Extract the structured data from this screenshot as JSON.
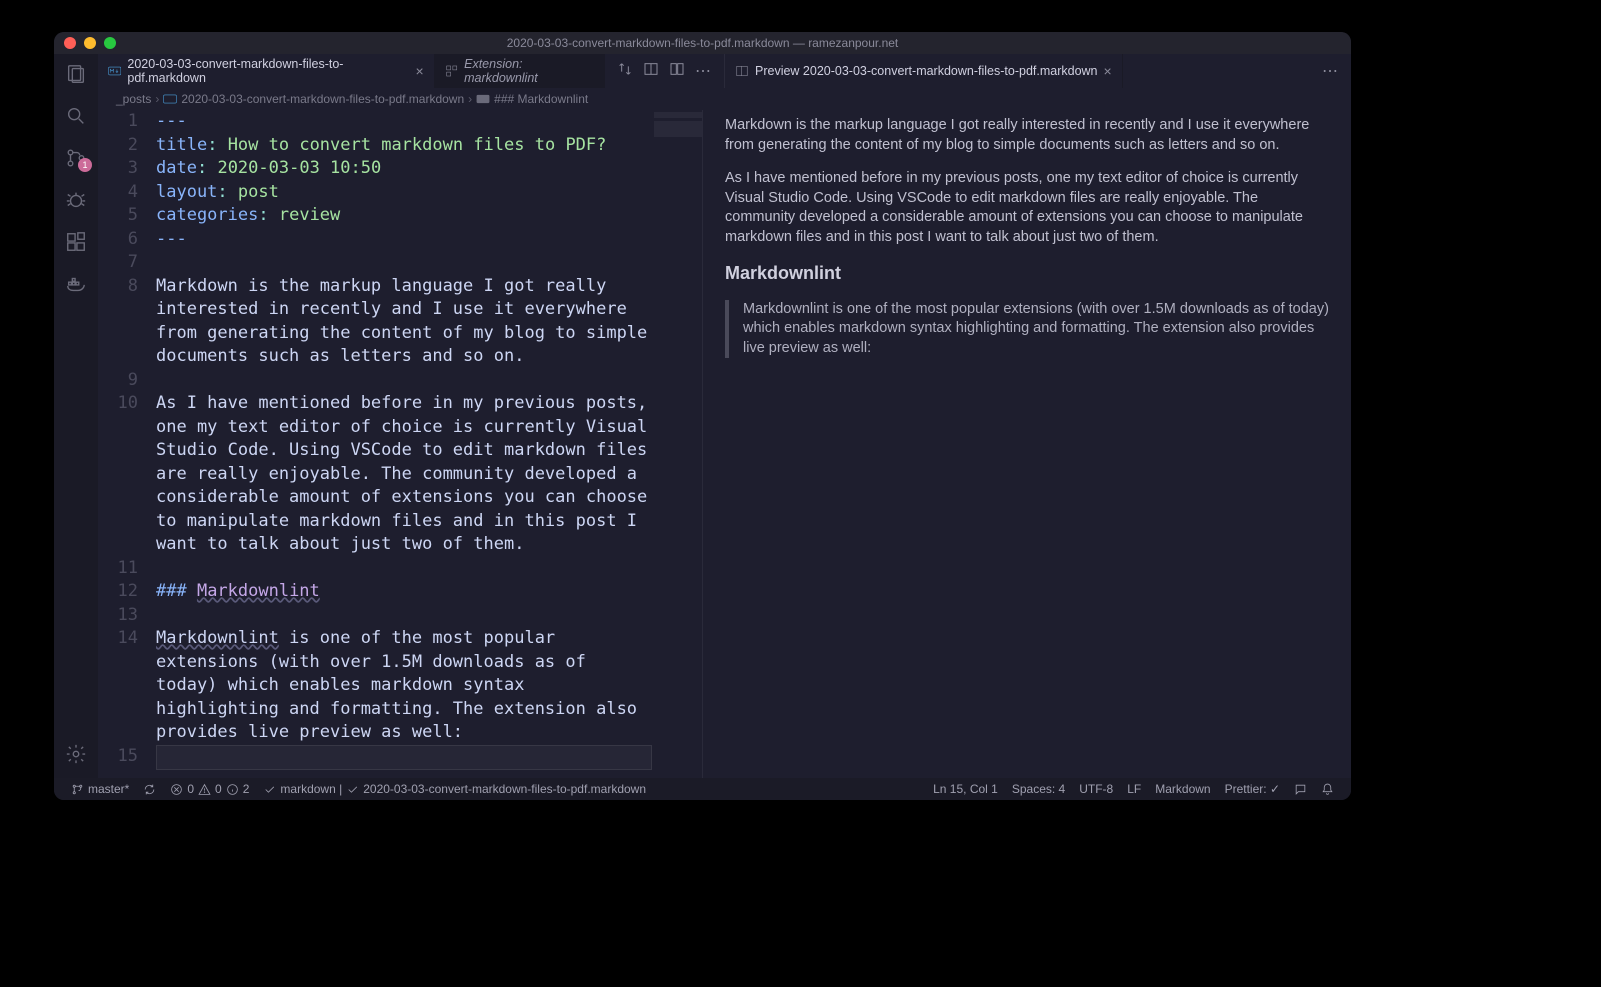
{
  "window": {
    "title": "2020-03-03-convert-markdown-files-to-pdf.markdown — ramezanpour.net"
  },
  "tabs": {
    "left": [
      {
        "icon": "markdown",
        "label": "2020-03-03-convert-markdown-files-to-pdf.markdown",
        "active": true,
        "closable": true
      },
      {
        "icon": "extension",
        "label": "Extension: markdownlint",
        "active": false,
        "italic": true
      }
    ],
    "right": [
      {
        "icon": "preview",
        "label": "Preview 2020-03-03-convert-markdown-files-to-pdf.markdown",
        "active": true,
        "closable": true
      }
    ]
  },
  "breadcrumbs": {
    "parts": [
      "_posts",
      "2020-03-03-convert-markdown-files-to-pdf.markdown",
      "### Markdownlint"
    ]
  },
  "editor": {
    "lines": [
      {
        "n": 1,
        "type": "frontmatter-delim",
        "text": "---"
      },
      {
        "n": 2,
        "type": "kv",
        "key": "title",
        "val": "How to convert markdown files to PDF?"
      },
      {
        "n": 3,
        "type": "kv",
        "key": "date",
        "val": "2020-03-03 10:50"
      },
      {
        "n": 4,
        "type": "kv",
        "key": "layout",
        "val": "post"
      },
      {
        "n": 5,
        "type": "kv",
        "key": "categories",
        "val": "review"
      },
      {
        "n": 6,
        "type": "frontmatter-delim",
        "text": "---"
      },
      {
        "n": 7,
        "type": "blank",
        "text": ""
      },
      {
        "n": 8,
        "type": "para",
        "text": "Markdown is the markup language I got really interested in recently and I use it everywhere from generating the content of my blog to simple documents such as letters and so on.",
        "wraps": 3
      },
      {
        "n": 9,
        "type": "blank",
        "text": ""
      },
      {
        "n": 10,
        "type": "para",
        "text": "As I have mentioned before in my previous posts, one my text editor of choice is currently Visual Studio Code. Using VSCode to edit markdown files are really enjoyable. The community developed a considerable amount of extensions you can choose to manipulate markdown files and in this post I want to talk about just two of them.",
        "wraps": 6
      },
      {
        "n": 11,
        "type": "blank",
        "text": ""
      },
      {
        "n": 12,
        "type": "heading",
        "hash": "### ",
        "text": "Markdownlint"
      },
      {
        "n": 13,
        "type": "blank",
        "text": ""
      },
      {
        "n": 14,
        "type": "para-link",
        "link": "Markdownlint",
        "text": " is one of the most popular extensions (with over 1.5M downloads as of today) which enables markdown syntax highlighting and formatting. The extension also provides live preview as well:",
        "wraps": 4
      },
      {
        "n": 15,
        "type": "cursor",
        "text": ""
      }
    ]
  },
  "preview": {
    "p1": "Markdown is the markup language I got really interested in recently and I use it everywhere from generating the content of my blog to simple documents such as letters and so on.",
    "p2": "As I have mentioned before in my previous posts, one my text editor of choice is currently Visual Studio Code. Using VSCode to edit markdown files are really enjoyable. The community developed a considerable amount of extensions you can choose to manipulate markdown files and in this post I want to talk about just two of them.",
    "h3": "Markdownlint",
    "bq": "Markdownlint is one of the most popular extensions (with over 1.5M downloads as of today) which enables markdown syntax highlighting and formatting. The extension also provides live preview as well:"
  },
  "activitybar": {
    "scm_badge": "1"
  },
  "statusbar": {
    "branch": "master*",
    "errors": "0",
    "warnings": "0",
    "infos": "2",
    "formatter": "markdown |",
    "file": "2020-03-03-convert-markdown-files-to-pdf.markdown",
    "lncol": "Ln 15, Col 1",
    "spaces": "Spaces: 4",
    "encoding": "UTF-8",
    "eol": "LF",
    "language": "Markdown",
    "prettier": "Prettier: ✓"
  }
}
